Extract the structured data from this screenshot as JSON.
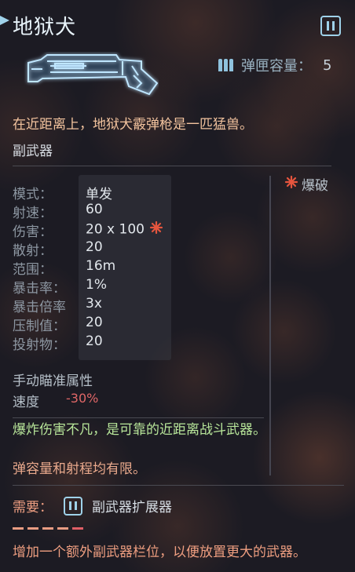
{
  "header": {
    "title": "地狱犬",
    "slot_icon": "secondary-slot-icon"
  },
  "weapon": {
    "icon": "shotgun-icon",
    "magazine_label": "弹匣容量：",
    "magazine_value": "5",
    "description": "在近距离上，地狱犬霰弹枪是一匹猛兽。",
    "category": "副武器"
  },
  "stats": [
    {
      "label": "模式：",
      "value": "单发"
    },
    {
      "label": "射速：",
      "value": "60"
    },
    {
      "label": "伤害：",
      "value": "20 x 100"
    },
    {
      "label": "散射：",
      "value": "20"
    },
    {
      "label": "范围：",
      "value": "16m"
    },
    {
      "label": "暴击率：",
      "value": "1%"
    },
    {
      "label": "暴击倍率",
      "value": "3x"
    },
    {
      "label": "压制值：",
      "value": "20"
    },
    {
      "label": "投射物：",
      "value": "20"
    }
  ],
  "trait": {
    "icon": "burst-icon",
    "label": "爆破",
    "color": "#e5553e"
  },
  "manual_aim": {
    "title": "手动瞄准属性",
    "speed_label": "速度",
    "speed_value": "-30%"
  },
  "pros": "爆炸伤害不凡，是可靠的近距离战斗武器。",
  "cons": "弹容量和射程均有限。",
  "requirement": {
    "label": "需要：",
    "icon": "secondary-slot-icon",
    "name": "副武器扩展器",
    "description": "增加一个额外副武器栏位，以便放置更大的武器。"
  },
  "colors": {
    "accent": "#9fd2ea",
    "description": "#f2c39e",
    "pro": "#b8e69a",
    "con": "#e9a98c",
    "negative": "#e06767"
  }
}
